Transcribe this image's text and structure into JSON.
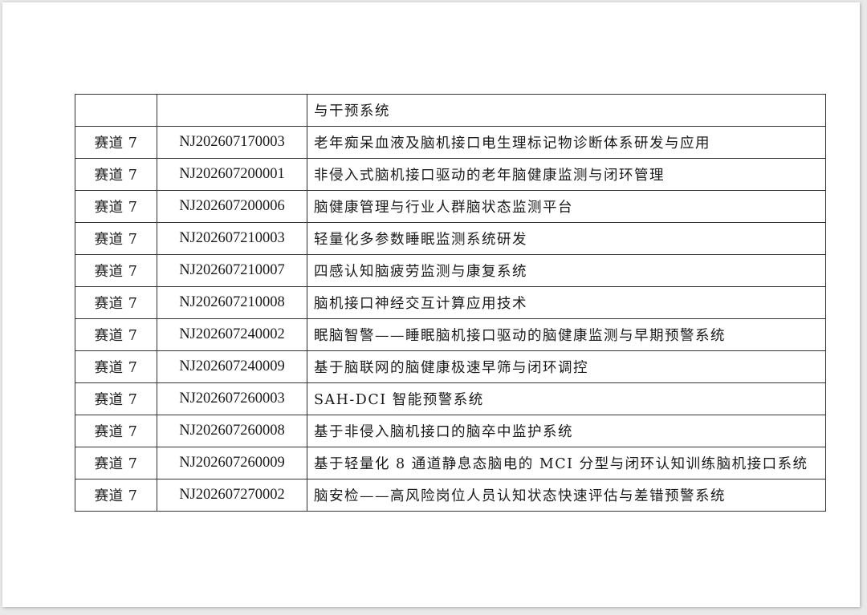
{
  "rows": [
    {
      "track": "",
      "id": "",
      "title": "与干预系统"
    },
    {
      "track": "赛道 7",
      "id": "NJ202607170003",
      "title": "老年痴呆血液及脑机接口电生理标记物诊断体系研发与应用"
    },
    {
      "track": "赛道 7",
      "id": "NJ202607200001",
      "title": "非侵入式脑机接口驱动的老年脑健康监测与闭环管理"
    },
    {
      "track": "赛道 7",
      "id": "NJ202607200006",
      "title": "脑健康管理与行业人群脑状态监测平台"
    },
    {
      "track": "赛道 7",
      "id": "NJ202607210003",
      "title": "轻量化多参数睡眠监测系统研发"
    },
    {
      "track": "赛道 7",
      "id": "NJ202607210007",
      "title": "四感认知脑疲劳监测与康复系统"
    },
    {
      "track": "赛道 7",
      "id": "NJ202607210008",
      "title": "脑机接口神经交互计算应用技术"
    },
    {
      "track": "赛道 7",
      "id": "NJ202607240002",
      "title": "眠脑智警——睡眠脑机接口驱动的脑健康监测与早期预警系统"
    },
    {
      "track": "赛道 7",
      "id": "NJ202607240009",
      "title": "基于脑联网的脑健康极速早筛与闭环调控"
    },
    {
      "track": "赛道 7",
      "id": "NJ202607260003",
      "title": "SAH-DCI 智能预警系统"
    },
    {
      "track": "赛道 7",
      "id": "NJ202607260008",
      "title": "基于非侵入脑机接口的脑卒中监护系统"
    },
    {
      "track": "赛道 7",
      "id": "NJ202607260009",
      "title": "基于轻量化 8 通道静息态脑电的 MCI 分型与闭环认知训练脑机接口系统"
    },
    {
      "track": "赛道 7",
      "id": "NJ202607270002",
      "title": "脑安检——高风险岗位人员认知状态快速评估与差错预警系统"
    }
  ]
}
